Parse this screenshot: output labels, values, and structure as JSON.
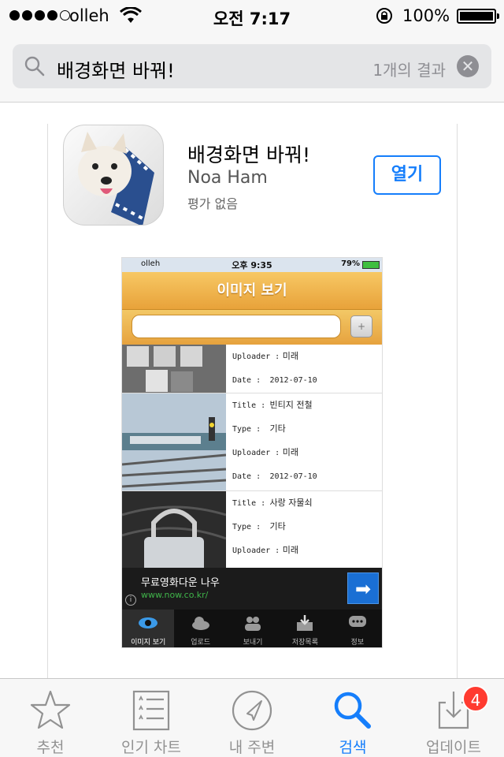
{
  "status_bar": {
    "carrier": "olleh",
    "time": "오전 7:17",
    "battery_percent": "100%"
  },
  "search": {
    "query": "배경화면 바꿔!",
    "result_count": "1개의 결과"
  },
  "app": {
    "name": "배경화면 바꿔!",
    "developer": "Noa Ham",
    "rating": "평가 없음",
    "open_label": "열기"
  },
  "screenshot": {
    "status": {
      "carrier": "olleh",
      "time": "오후 9:35",
      "battery": "79%"
    },
    "header_title": "이미지 보기",
    "rows": [
      {
        "uploader_key": "Uploader :",
        "uploader": "미래",
        "date_key": "Date :",
        "date": "2012-07-10"
      },
      {
        "title_key": "Title :",
        "title": "빈티지 전철",
        "type_key": "Type :",
        "type": "기타",
        "uploader_key": "Uploader :",
        "uploader": "미래",
        "date_key": "Date :",
        "date": "2012-07-10"
      },
      {
        "title_key": "Title :",
        "title": "사랑 자물쇠",
        "type_key": "Type :",
        "type": "기타",
        "uploader_key": "Uploader :",
        "uploader": "미래"
      }
    ],
    "ad": {
      "title": "무료영화다운 나우",
      "url": "www.now.co.kr/"
    },
    "tabs": [
      "이미지 보기",
      "업로드",
      "보내기",
      "저장목록",
      "정보"
    ]
  },
  "tabbar": {
    "items": [
      {
        "label": "추천",
        "icon": "star-icon"
      },
      {
        "label": "인기 차트",
        "icon": "list-icon"
      },
      {
        "label": "내 주변",
        "icon": "location-icon"
      },
      {
        "label": "검색",
        "icon": "search-icon"
      },
      {
        "label": "업데이트",
        "icon": "download-icon"
      }
    ],
    "active_index": 3,
    "update_badge": "4"
  },
  "colors": {
    "accent": "#157efb",
    "badge": "#ff3b30"
  }
}
